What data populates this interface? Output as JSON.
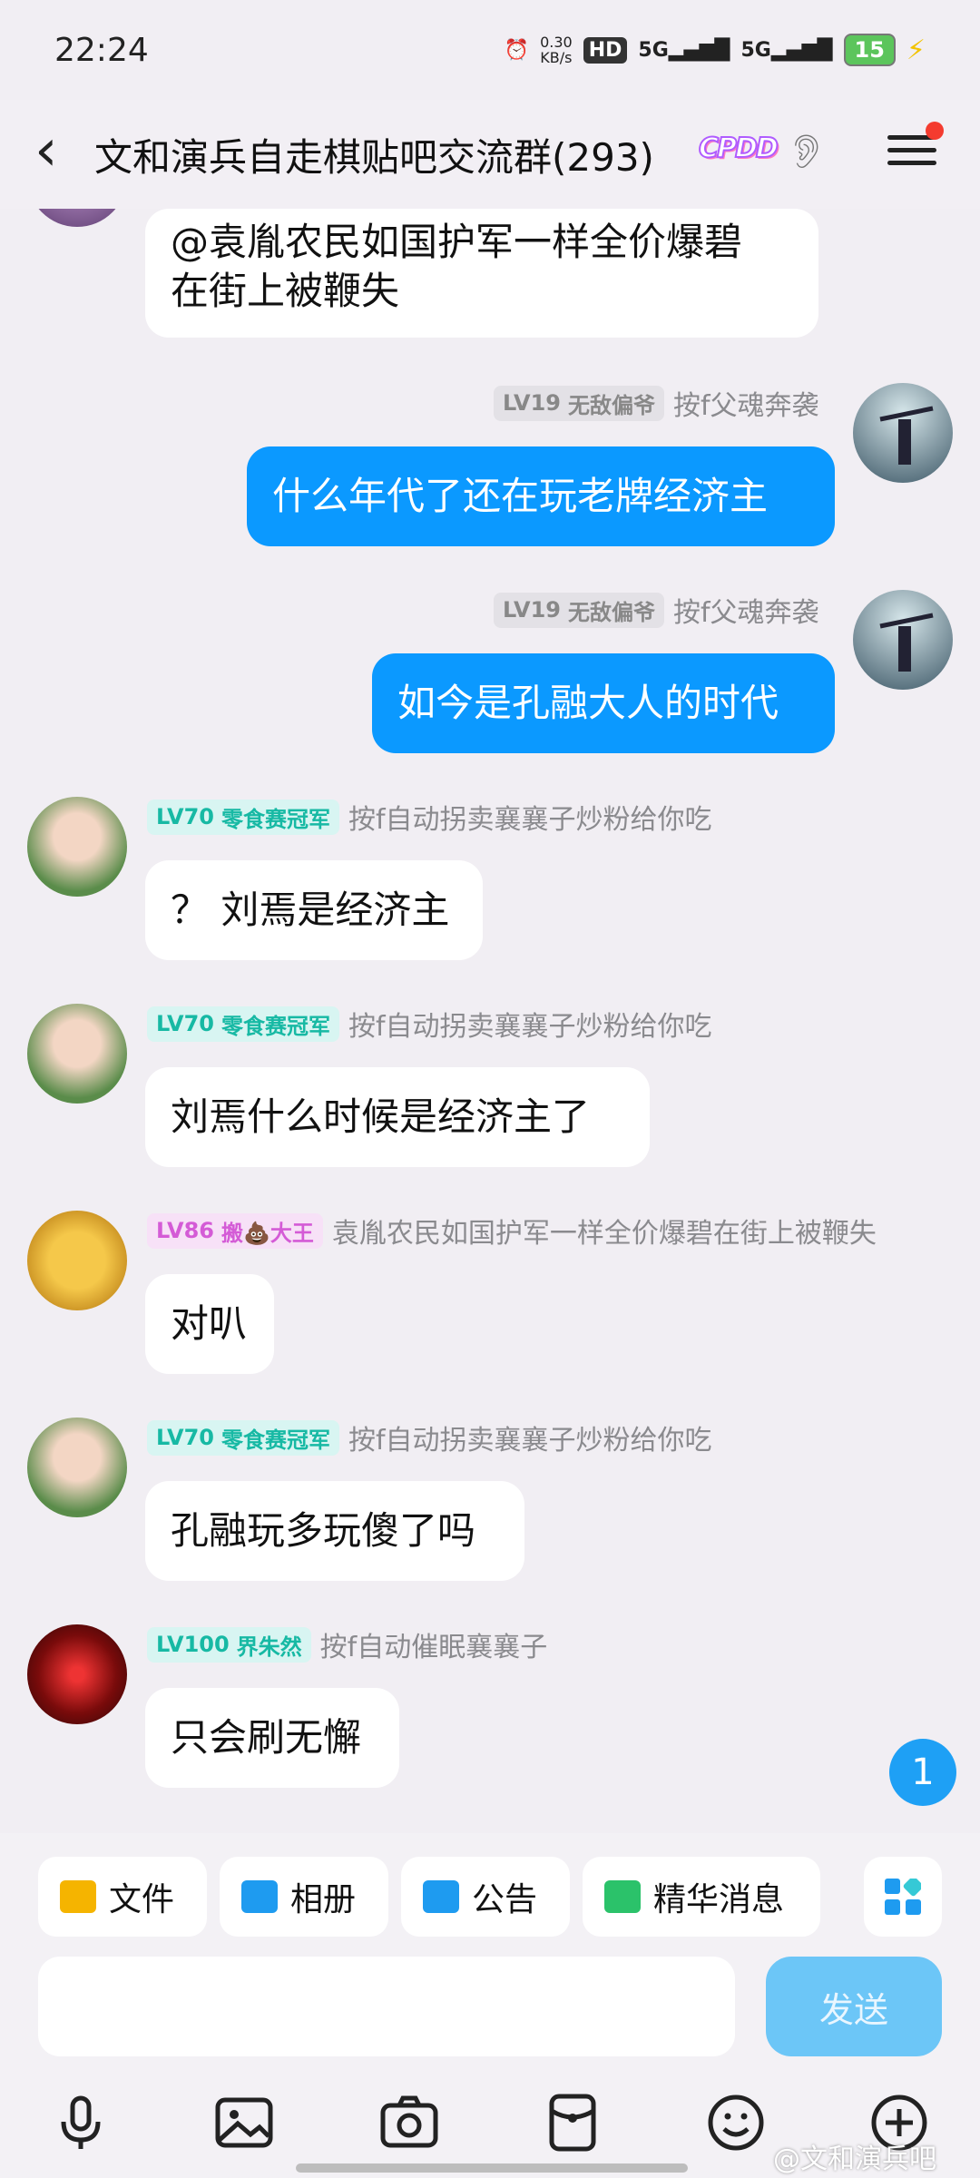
{
  "status": {
    "time": "22:24",
    "net_speed": "0.30",
    "net_unit": "KB/s",
    "hd": "HD",
    "sig1": "5G",
    "sig2": "5G",
    "battery": "15"
  },
  "header": {
    "title": "文和演兵自走棋贴吧交流群(293)",
    "tag": "CPDD"
  },
  "messages": [
    {
      "text": "@袁胤农民如国护军一样全价爆碧在街上被鞭失",
      "line1": "@袁胤农民如国护军一样全价爆碧",
      "line2": "在街上被鞭失"
    },
    {
      "level": "LV19",
      "title": "无敌偏爷",
      "sender": "按f父魂奔袭",
      "text": "什么年代了还在玩老牌经济主"
    },
    {
      "level": "LV19",
      "title": "无敌偏爷",
      "sender": "按f父魂奔袭",
      "text": "如今是孔融大人的时代"
    },
    {
      "level": "LV70",
      "title": "零食赛冠军",
      "sender": "按f自动拐卖襄襄子炒粉给你吃",
      "text": "？ 刘焉是经济主"
    },
    {
      "level": "LV70",
      "title": "零食赛冠军",
      "sender": "按f自动拐卖襄襄子炒粉给你吃",
      "text": "刘焉什么时候是经济主了"
    },
    {
      "level": "LV86",
      "title": "搬💩大王",
      "sender": "袁胤农民如国护军一样全价爆碧在街上被鞭失",
      "text": "对叭"
    },
    {
      "level": "LV70",
      "title": "零食赛冠军",
      "sender": "按f自动拐卖襄襄子炒粉给你吃",
      "text": "孔融玩多玩傻了吗"
    },
    {
      "level": "LV100",
      "title": "界朱然",
      "sender": "按f自动催眠襄襄子",
      "text": "只会刷无懈"
    }
  ],
  "unread_count": "1",
  "quick_actions": {
    "file": "文件",
    "album": "相册",
    "notice": "公告",
    "essence": "精华消息"
  },
  "input": {
    "placeholder": "",
    "send_label": "发送"
  },
  "watermark": "@文和演兵吧"
}
